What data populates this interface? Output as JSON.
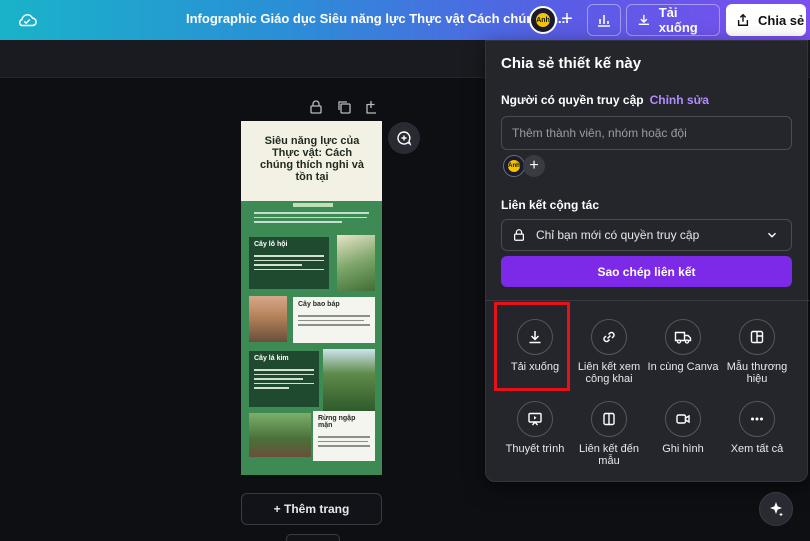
{
  "topbar": {
    "title": "Infographic Giáo dục Siêu năng lực Thực vật Cách chúng th...",
    "avatar_text": "Anh",
    "download_label": "Tải xuống",
    "share_label": "Chia sẻ"
  },
  "design": {
    "header_title": "Siêu năng lực của Thực vật: Cách chúng thích nghi và tồn tại",
    "cards": [
      "Cây lô hội",
      "Cây bao báp",
      "Cây lá kim",
      "Rừng ngập mặn"
    ]
  },
  "canvas": {
    "add_page_label": "+ Thêm trang"
  },
  "share_panel": {
    "title": "Chia sẻ thiết kế này",
    "access_label": "Người có quyền truy cập",
    "edit_link": "Chỉnh sửa",
    "member_placeholder": "Thêm thành viên, nhóm hoặc đội",
    "collab_label": "Liên kết cộng tác",
    "collab_value": "Chỉ bạn mới có quyền truy cập",
    "copy_button": "Sao chép liên kết",
    "options": [
      {
        "label": "Tải xuống",
        "icon": "download-icon"
      },
      {
        "label": "Liên kết xem công khai",
        "icon": "link-icon"
      },
      {
        "label": "In cùng Canva",
        "icon": "truck-icon"
      },
      {
        "label": "Mẫu thương hiệu",
        "icon": "template-icon"
      },
      {
        "label": "Thuyết trình",
        "icon": "present-icon"
      },
      {
        "label": "Liên kết đến mẫu",
        "icon": "layout-icon"
      },
      {
        "label": "Ghi hình",
        "icon": "camera-icon"
      },
      {
        "label": "Xem tất cả",
        "icon": "more-icon"
      }
    ]
  }
}
